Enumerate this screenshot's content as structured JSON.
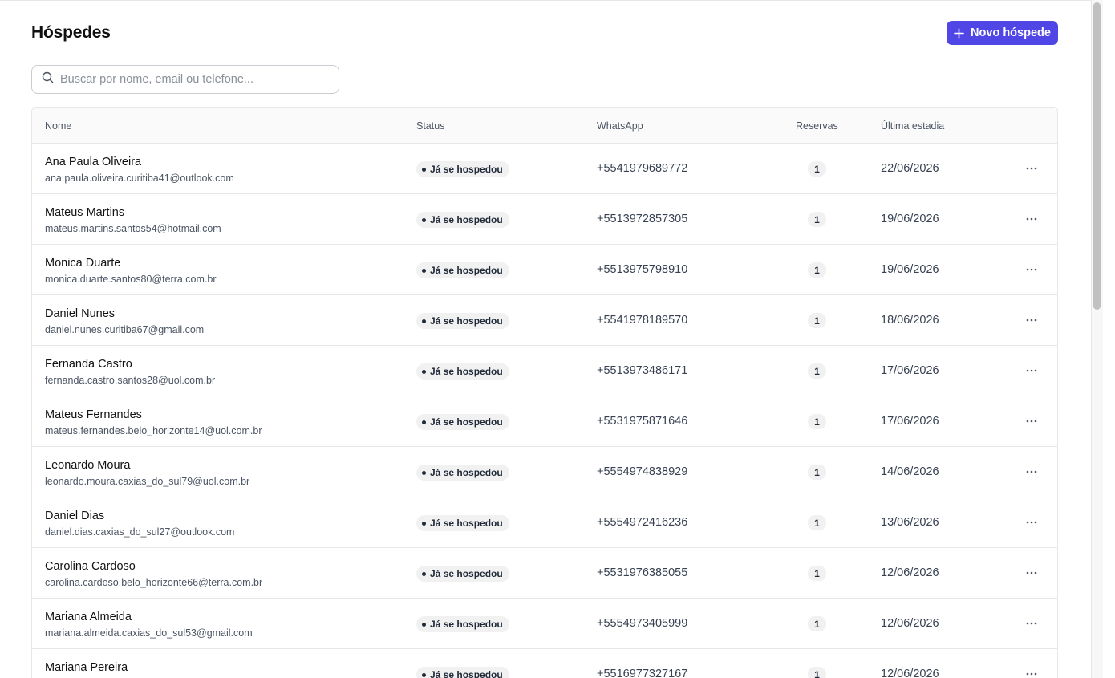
{
  "page": {
    "title": "Hóspedes"
  },
  "header": {
    "new_button_label": "Novo hóspede"
  },
  "search": {
    "placeholder": "Buscar por nome, email ou telefone...",
    "value": ""
  },
  "table": {
    "columns": [
      "Nome",
      "Status",
      "WhatsApp",
      "Reservas",
      "Última estadia"
    ],
    "rows": [
      {
        "name": "Ana Paula Oliveira",
        "email": "ana.paula.oliveira.curitiba41@outlook.com",
        "status": "Já se hospedou",
        "whatsapp": "+5541979689772",
        "reservas": "1",
        "ultima_estadia": "22/06/2026"
      },
      {
        "name": "Mateus Martins",
        "email": "mateus.martins.santos54@hotmail.com",
        "status": "Já se hospedou",
        "whatsapp": "+5513972857305",
        "reservas": "1",
        "ultima_estadia": "19/06/2026"
      },
      {
        "name": "Monica Duarte",
        "email": "monica.duarte.santos80@terra.com.br",
        "status": "Já se hospedou",
        "whatsapp": "+5513975798910",
        "reservas": "1",
        "ultima_estadia": "19/06/2026"
      },
      {
        "name": "Daniel Nunes",
        "email": "daniel.nunes.curitiba67@gmail.com",
        "status": "Já se hospedou",
        "whatsapp": "+5541978189570",
        "reservas": "1",
        "ultima_estadia": "18/06/2026"
      },
      {
        "name": "Fernanda Castro",
        "email": "fernanda.castro.santos28@uol.com.br",
        "status": "Já se hospedou",
        "whatsapp": "+5513973486171",
        "reservas": "1",
        "ultima_estadia": "17/06/2026"
      },
      {
        "name": "Mateus Fernandes",
        "email": "mateus.fernandes.belo_horizonte14@uol.com.br",
        "status": "Já se hospedou",
        "whatsapp": "+5531975871646",
        "reservas": "1",
        "ultima_estadia": "17/06/2026"
      },
      {
        "name": "Leonardo Moura",
        "email": "leonardo.moura.caxias_do_sul79@uol.com.br",
        "status": "Já se hospedou",
        "whatsapp": "+5554974838929",
        "reservas": "1",
        "ultima_estadia": "14/06/2026"
      },
      {
        "name": "Daniel Dias",
        "email": "daniel.dias.caxias_do_sul27@outlook.com",
        "status": "Já se hospedou",
        "whatsapp": "+5554972416236",
        "reservas": "1",
        "ultima_estadia": "13/06/2026"
      },
      {
        "name": "Carolina Cardoso",
        "email": "carolina.cardoso.belo_horizonte66@terra.com.br",
        "status": "Já se hospedou",
        "whatsapp": "+5531976385055",
        "reservas": "1",
        "ultima_estadia": "12/06/2026"
      },
      {
        "name": "Mariana Almeida",
        "email": "mariana.almeida.caxias_do_sul53@gmail.com",
        "status": "Já se hospedou",
        "whatsapp": "+5554973405999",
        "reservas": "1",
        "ultima_estadia": "12/06/2026"
      },
      {
        "name": "Mariana Pereira",
        "email": "",
        "status": "Já se hospedou",
        "whatsapp": "+5516977327167",
        "reservas": "1",
        "ultima_estadia": "12/06/2026"
      }
    ]
  },
  "icons": {
    "new_button": "plus-icon",
    "search": "search-icon",
    "row_actions": "more-horizontal-icon"
  },
  "colors": {
    "accent": "#4f46e5",
    "badge_bg": "#f1f1f2",
    "border": "#e5e7eb"
  }
}
